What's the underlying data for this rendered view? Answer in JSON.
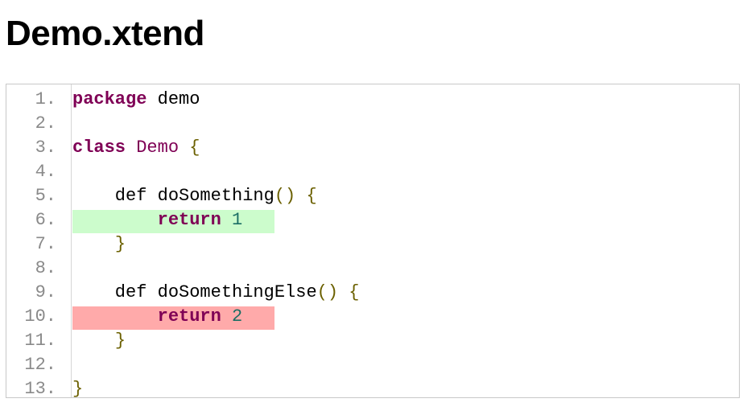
{
  "page": {
    "title": "Demo.xtend"
  },
  "coverage_colors": {
    "covered": "#ccfccc",
    "uncovered": "#ffaaaa"
  },
  "lines": [
    {
      "number": "1.",
      "tokens": [
        {
          "kind": "keyword",
          "text": "package"
        },
        {
          "kind": "plain",
          "text": " demo"
        }
      ]
    },
    {
      "number": "2.",
      "tokens": []
    },
    {
      "number": "3.",
      "tokens": [
        {
          "kind": "keyword",
          "text": "class"
        },
        {
          "kind": "plain",
          "text": " "
        },
        {
          "kind": "type",
          "text": "Demo"
        },
        {
          "kind": "plain",
          "text": " "
        },
        {
          "kind": "punct",
          "text": "{"
        }
      ]
    },
    {
      "number": "4.",
      "tokens": []
    },
    {
      "number": "5.",
      "tokens": [
        {
          "kind": "plain",
          "text": "    def doSomething"
        },
        {
          "kind": "punct",
          "text": "()"
        },
        {
          "kind": "plain",
          "text": " "
        },
        {
          "kind": "punct",
          "text": "{"
        }
      ]
    },
    {
      "number": "6.",
      "coverage": "covered",
      "tokens": [
        {
          "kind": "plain",
          "text": "        "
        },
        {
          "kind": "keyword",
          "text": "return"
        },
        {
          "kind": "plain",
          "text": " "
        },
        {
          "kind": "number",
          "text": "1"
        }
      ]
    },
    {
      "number": "7.",
      "tokens": [
        {
          "kind": "plain",
          "text": "    "
        },
        {
          "kind": "punct",
          "text": "}"
        }
      ]
    },
    {
      "number": "8.",
      "tokens": []
    },
    {
      "number": "9.",
      "tokens": [
        {
          "kind": "plain",
          "text": "    def doSomethingElse"
        },
        {
          "kind": "punct",
          "text": "()"
        },
        {
          "kind": "plain",
          "text": " "
        },
        {
          "kind": "punct",
          "text": "{"
        }
      ]
    },
    {
      "number": "10.",
      "coverage": "uncovered",
      "tokens": [
        {
          "kind": "plain",
          "text": "        "
        },
        {
          "kind": "keyword",
          "text": "return"
        },
        {
          "kind": "plain",
          "text": " "
        },
        {
          "kind": "number",
          "text": "2"
        }
      ]
    },
    {
      "number": "11.",
      "tokens": [
        {
          "kind": "plain",
          "text": "    "
        },
        {
          "kind": "punct",
          "text": "}"
        }
      ]
    },
    {
      "number": "12.",
      "tokens": []
    },
    {
      "number": "13.",
      "tokens": [
        {
          "kind": "punct",
          "text": "}"
        }
      ]
    }
  ]
}
